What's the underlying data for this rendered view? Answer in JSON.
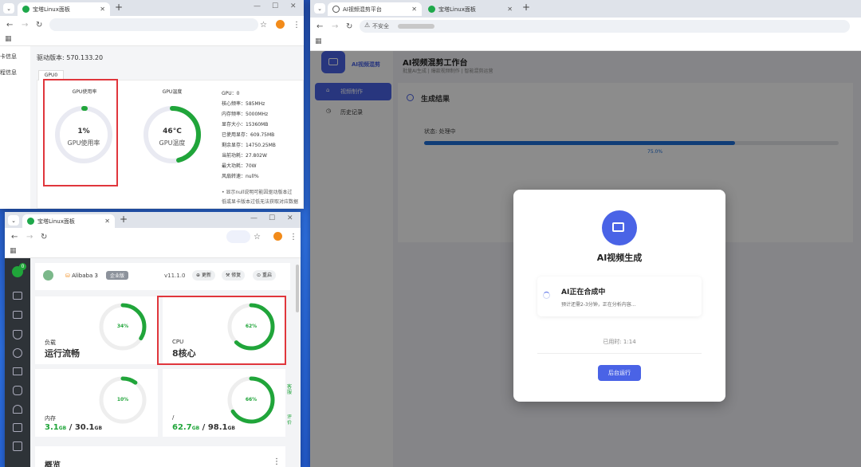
{
  "win1": {
    "tab_title": "宝塔Linux面板",
    "driver_version": "驱动版本: 570.133.20",
    "left_nav": [
      "卡信息",
      "程信息"
    ],
    "gpu_tab": "GPU0",
    "usage_caption": "GPU使用率",
    "usage_value": "1%",
    "usage_label": "GPU使用率",
    "usage_percent": 1,
    "temp_caption": "GPU温度",
    "temp_value": "46°C",
    "temp_label": "GPU温度",
    "temp_percent": 46,
    "stats": [
      "GPU：0",
      "核心频率：585MHz",
      "内存频率：5000MHz",
      "显存大小：15360MB",
      "已使用显存：609.75MB",
      "剩余显存：14750.25MB",
      "当前功耗：27.802W",
      "最大功耗：70W",
      "风扇转速：null%"
    ],
    "note_line1": "• 显示null说明可能因驱动版本过",
    "note_line2": "低或显卡版本过低无法获取对应数据"
  },
  "win2": {
    "tab_title": "宝塔Linux面板",
    "server_name": "Alibaba 3",
    "edition_badge": "企业版",
    "version": "v11.1.0",
    "btn_update": "更新",
    "btn_repair": "修复",
    "btn_restart": "重启",
    "notify_count": "0",
    "load": {
      "percent": 34,
      "label": "34%",
      "title": "负载",
      "value": "运行流畅"
    },
    "cpu": {
      "percent": 62,
      "label": "62%",
      "title": "CPU",
      "value": "8核心"
    },
    "memory": {
      "percent": 10,
      "label": "10%",
      "title": "内存",
      "used": "3.1",
      "total": "30.1",
      "unit": "GB"
    },
    "disk": {
      "percent": 66,
      "label": "66%",
      "title": "/",
      "used": "62.7",
      "total": "98.1",
      "unit": "GB"
    },
    "side_actions": [
      "客服",
      "评价"
    ],
    "overview_title": "概览",
    "sidebar_icons": [
      "home-icon",
      "monitor-icon",
      "shield-icon",
      "globe-icon",
      "folder-icon",
      "database-icon",
      "users-icon",
      "terminal-icon",
      "package-icon"
    ]
  },
  "win3": {
    "tab1_title": "AI视频混剪平台",
    "tab2_title": "宝塔Linux面板",
    "security": "不安全",
    "app_name": "AI视频混剪",
    "page_title": "AI视频混剪工作台",
    "page_subtitle": "批量AI生成 | 爆款视频制作 | 智能混剪运营",
    "menu": [
      "视频制作",
      "历史记录"
    ],
    "section_title": "生成结果",
    "status": "状态: 处理中",
    "progress_percent": 75,
    "progress_label": "75.0%",
    "modal": {
      "title": "AI视频生成",
      "composing": "AI正在合成中",
      "eta": "预计还需2-3分钟，正在分析内容...",
      "elapsed": "已用时: 1:14",
      "bg_button": "后台运行"
    }
  },
  "colors": {
    "green": "#20a53a",
    "blue_accent": "#4a63e6",
    "progress": "#1e6fd9",
    "red_box": "#e0363c"
  }
}
